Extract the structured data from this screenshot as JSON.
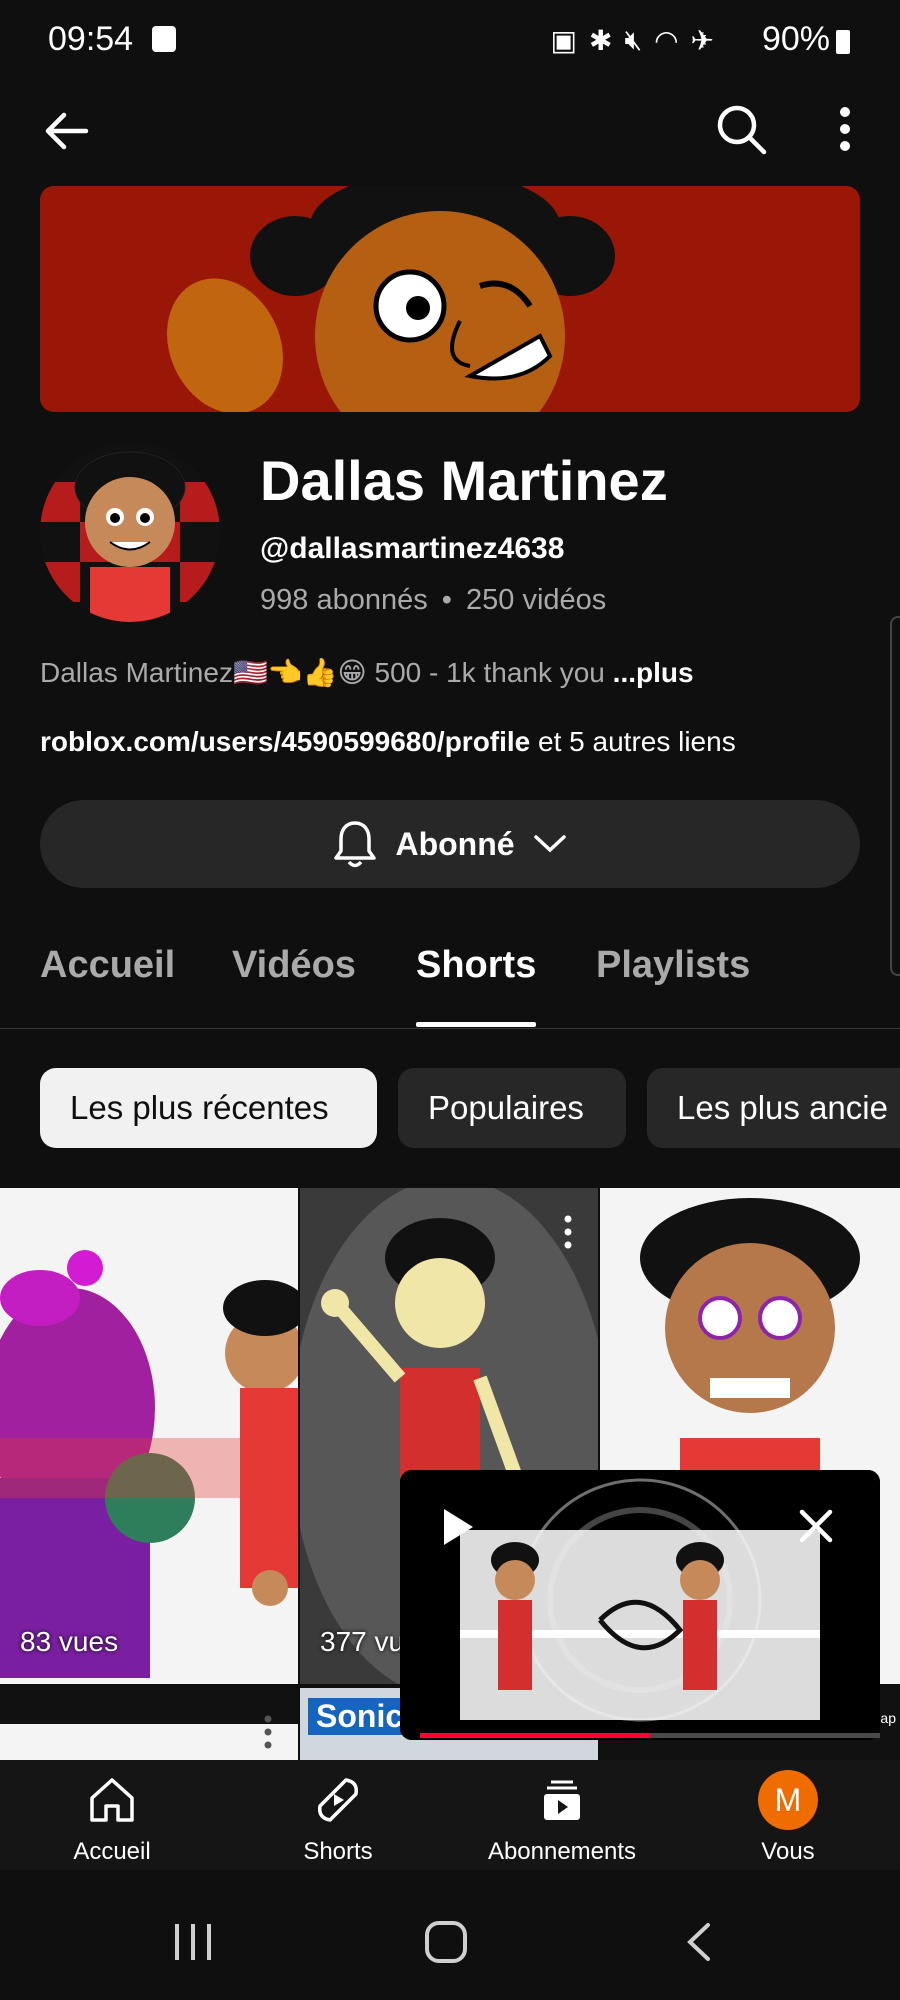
{
  "status_bar": {
    "time": "09:54",
    "battery": "90%"
  },
  "channel": {
    "name": "Dallas Martinez",
    "handle": "@dallasmartinez4638",
    "subscribers": "998 abonnés",
    "videos": "250 vidéos",
    "separator": "•",
    "description": "Dallas Martinez🇺🇸👈👍😁 500 - 1k thank you",
    "more_label": "...plus",
    "link_url": "roblox.com/users/4590599680/profile",
    "link_more": "et 5 autres liens",
    "subscribe_label": "Abonné"
  },
  "tabs": [
    "Accueil",
    "Vidéos",
    "Shorts",
    "Playlists"
  ],
  "active_tab": "Shorts",
  "chips": [
    "Les plus récentes",
    "Populaires",
    "Les plus ancie"
  ],
  "shorts": [
    {
      "views": "83 vues"
    },
    {
      "views": "377 vu"
    },
    {
      "views": ""
    }
  ],
  "row2": {
    "label_2": "Sonic_",
    "label_3": "Cap"
  },
  "mini_player": {
    "progress": 0.5
  },
  "bottom_nav": [
    {
      "label": "Accueil",
      "icon": "home-icon"
    },
    {
      "label": "Shorts",
      "icon": "shorts-icon"
    },
    {
      "label": "Abonnements",
      "icon": "subscriptions-icon"
    },
    {
      "label": "Vous",
      "icon": "avatar",
      "initial": "M"
    }
  ],
  "colors": {
    "background": "#0f0f0f",
    "banner": "#9a1708",
    "accent": "#ff0033",
    "avatar": "#ef6c00"
  }
}
